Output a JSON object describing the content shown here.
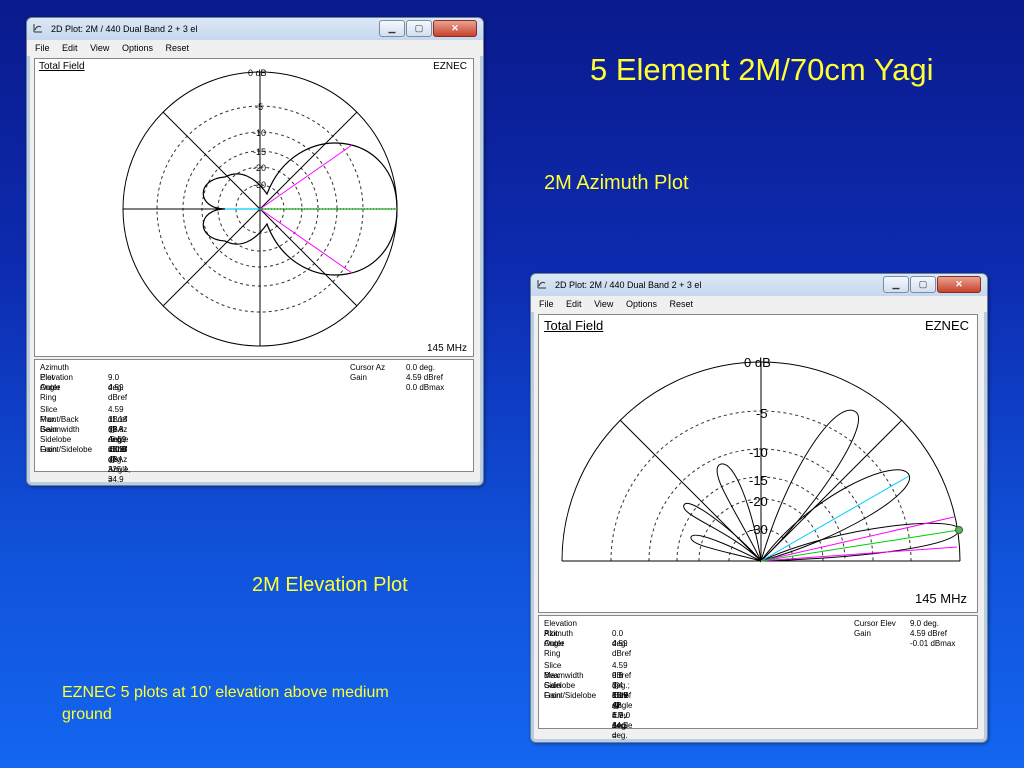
{
  "slide": {
    "title": "5 Element 2M/70cm Yagi",
    "caption_azimuth": "2M Azimuth Plot",
    "caption_elevation": "2M Elevation Plot",
    "note": "EZNEC 5 plots at 10’ elevation above medium ground"
  },
  "windows": {
    "azimuth": {
      "title": "2D Plot: 2M / 440 Dual Band 2 + 3 el",
      "menu": [
        "File",
        "Edit",
        "View",
        "Options",
        "Reset"
      ],
      "plot_title": "Total Field",
      "brand": "EZNEC",
      "frequency": "145 MHz",
      "ring_labels": [
        "0 dB",
        "-5",
        "-10",
        "-15",
        "-20",
        "-30"
      ],
      "info_left": [
        [
          "Azimuth Plot",
          ""
        ],
        [
          "Elevation Angle",
          "9.0 deg."
        ],
        [
          "Outer Ring",
          "4.59 dBref"
        ],
        [
          "",
          ""
        ],
        [
          "Slice Max Gain",
          "4.59 dBref @ Az Angle = 0.0 deg."
        ],
        [
          "Front/Back",
          "11.18 dB"
        ],
        [
          "Beamwidth",
          "69.8 deg.; -3dB @ 325.1, 34.9 deg."
        ],
        [
          "Sidelobe Gain",
          "-6.59 dBref @ Az Angle = 180.0 deg."
        ],
        [
          "Front/Sidelobe",
          "11.18 dB"
        ]
      ],
      "info_right": [
        [
          "Cursor Az",
          "0.0 deg."
        ],
        [
          "Gain",
          "4.59 dBref"
        ],
        [
          "",
          "0.0 dBmax"
        ]
      ]
    },
    "elevation": {
      "title": "2D Plot: 2M / 440 Dual Band 2 + 3 el",
      "menu": [
        "File",
        "Edit",
        "View",
        "Options",
        "Reset"
      ],
      "plot_title": "Total Field",
      "brand": "EZNEC",
      "frequency": "145 MHz",
      "ring_labels": [
        "0 dB",
        "-5",
        "-10",
        "-15",
        "-20",
        "-30"
      ],
      "info_left": [
        [
          "Elevation Plot",
          ""
        ],
        [
          "Azimuth Angle",
          "0.0 deg."
        ],
        [
          "Outer Ring",
          "4.59 dBref"
        ],
        [
          "",
          ""
        ],
        [
          "Slice Max Gain",
          "4.59 dBref @ Elev Angle = 9.0 deg."
        ],
        [
          "Beamwidth",
          "9.8 deg.; -3dB @ 4.7, 14.5 deg."
        ],
        [
          "Sidelobe Gain",
          "3.4 dBref @ Elev Angle = 30.0 deg."
        ],
        [
          "Front/Sidelobe",
          "1.19 dB"
        ]
      ],
      "info_right": [
        [
          "Cursor Elev",
          "9.0 deg."
        ],
        [
          "Gain",
          "4.59 dBref"
        ],
        [
          "",
          "-0.01 dBmax"
        ]
      ]
    }
  },
  "colors": {
    "slide_text": "#ffff33",
    "beamwidth_line": "#ff00ff",
    "cursor_line": "#00cc00",
    "sidelobe_line": "#00ccff"
  }
}
